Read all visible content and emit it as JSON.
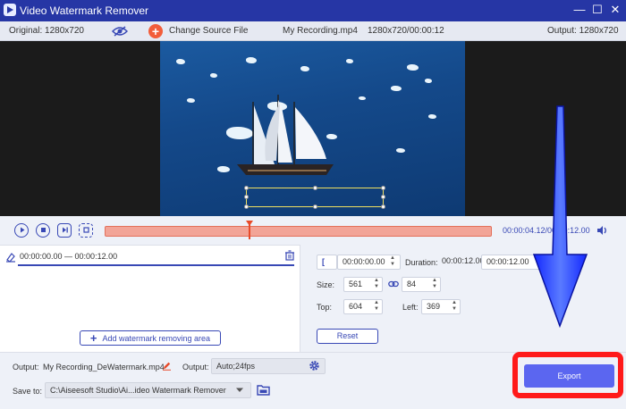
{
  "window": {
    "title": "Video Watermark Remover",
    "minimize": "—",
    "maximize": "☐",
    "close": "✕"
  },
  "infobar": {
    "original": "Original: 1280x720",
    "change_source": "Change Source File",
    "file_name": "My Recording.mp4",
    "file_info": "1280x720/00:00:12",
    "output": "Output: 1280x720"
  },
  "playback": {
    "timecode": "00:00:04.12/00:00:12.00"
  },
  "segment": {
    "range": "00:00:00.00 — 00:00:12.00",
    "add_area_label": "Add watermark removing area"
  },
  "clip_settings": {
    "start_time": "00:00:00.00",
    "duration_label": "Duration:",
    "duration_value": "00:00:12.00",
    "end_time": "00:00:12.00",
    "size_label": "Size:",
    "width": "561",
    "height": "84",
    "top_label": "Top:",
    "top": "604",
    "left_label": "Left:",
    "left": "369",
    "reset_label": "Reset"
  },
  "output": {
    "output_label": "Output:",
    "file_name": "My Recording_DeWatermark.mp4",
    "format_label": "Output:",
    "format": "Auto;24fps",
    "save_to_label": "Save to:",
    "save_path": "C:\\Aiseesoft Studio\\Ai...ideo Watermark Remover",
    "export_label": "Export"
  },
  "colors": {
    "titlebar": "#2636a5",
    "accent": "#3848b5",
    "export": "#5b66f0",
    "highlight": "#ff1a1a",
    "arrow": "#1428ff"
  }
}
